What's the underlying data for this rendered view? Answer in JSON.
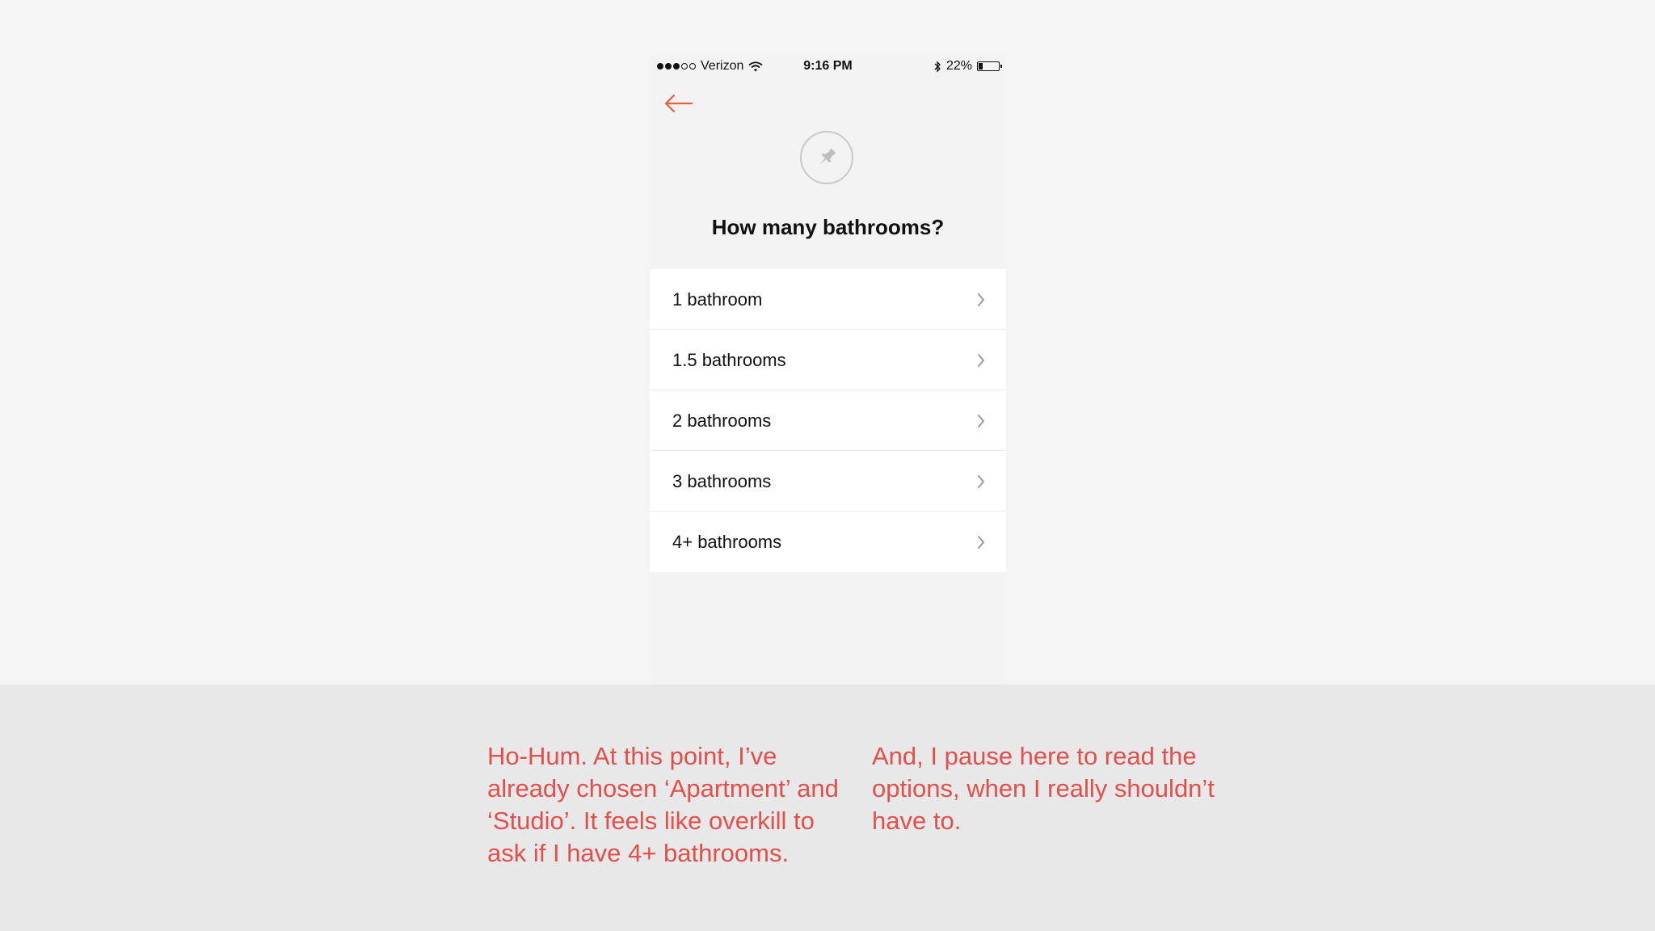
{
  "status_bar": {
    "signal_full": 3,
    "signal_empty": 2,
    "carrier": "Verizon",
    "time": "9:16 PM",
    "battery_percent_text": "22%",
    "battery_level": 0.22
  },
  "icons": {
    "back": "arrow-left-icon",
    "pin": "pushpin-icon",
    "chevron": "chevron-right-icon",
    "wifi": "wifi-icon",
    "bluetooth": "bluetooth-icon"
  },
  "colors": {
    "accent": "#e8613c",
    "caption_text": "#e0504d",
    "option_bg": "#ffffff",
    "screen_bg": "#f3f3f3"
  },
  "question": "How many bathrooms?",
  "options": [
    {
      "label": "1 bathroom"
    },
    {
      "label": "1.5 bathrooms"
    },
    {
      "label": "2 bathrooms"
    },
    {
      "label": "3 bathrooms"
    },
    {
      "label": "4+ bathrooms"
    }
  ],
  "captions": {
    "left": "Ho-Hum. At this point, I’ve already chosen ‘Apartment’ and ‘Studio’. It feels like overkill to ask if I have 4+ bathrooms.",
    "right": "And, I pause here to read the options, when I really shouldn’t have to."
  }
}
